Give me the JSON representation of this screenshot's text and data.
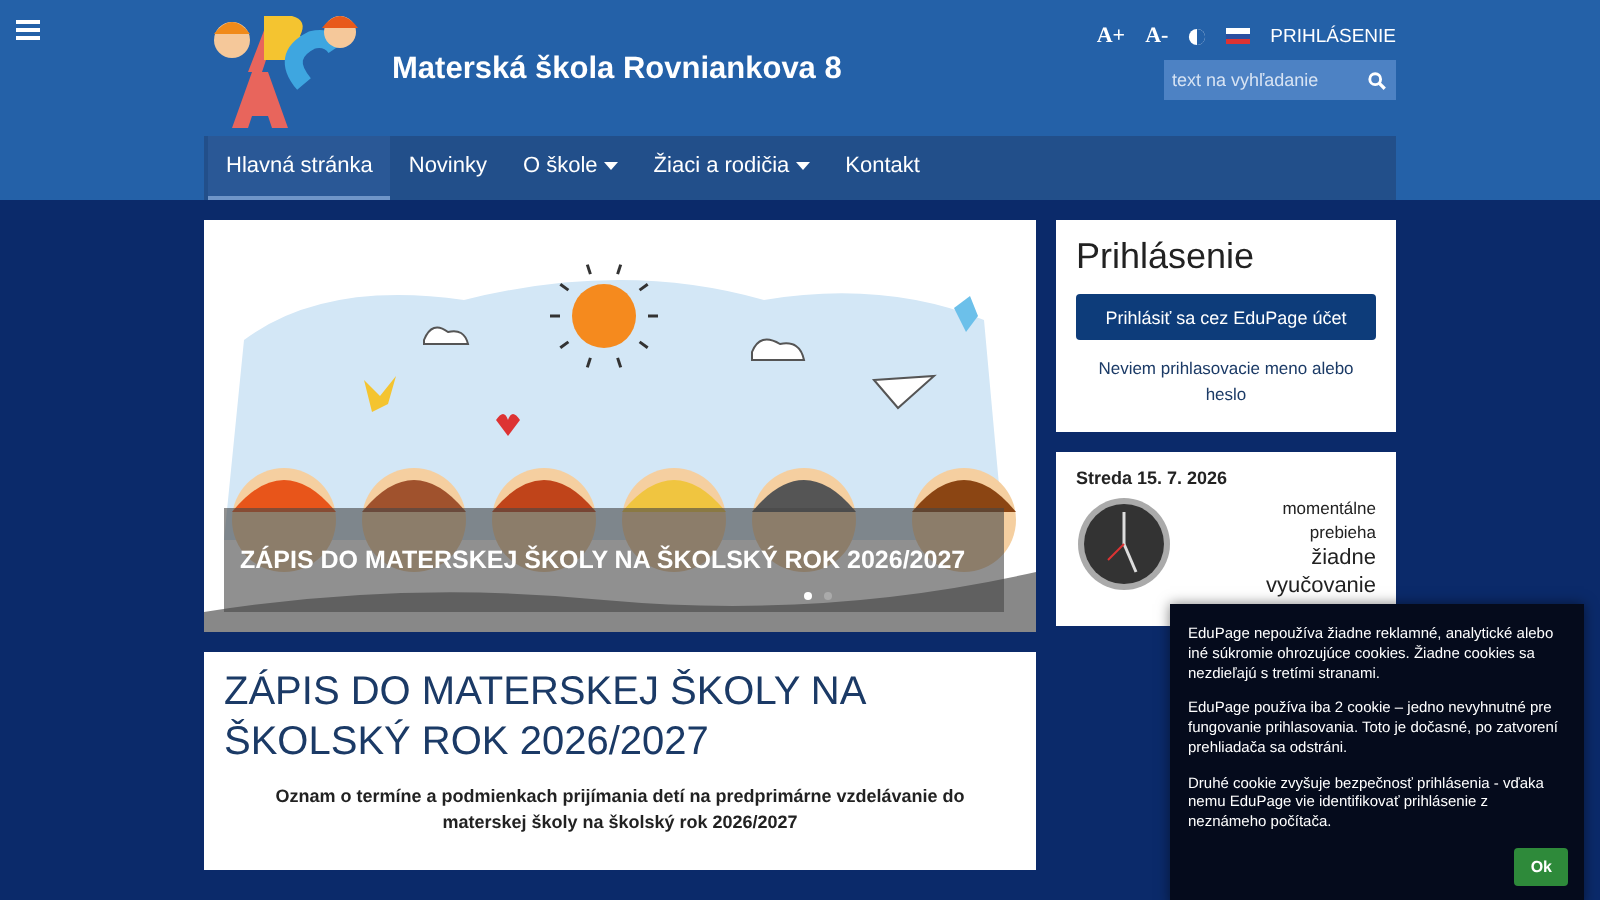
{
  "header": {
    "title": "Materská škola Rovniankova 8",
    "tools": [
      "A+",
      "A-"
    ],
    "login_link": "PRIHLÁSENIE",
    "search": {
      "placeholder": "text na vyhľadanie"
    }
  },
  "nav": [
    {
      "label": "Hlavná stránka",
      "selected": true,
      "dropdown": false
    },
    {
      "label": "Novinky",
      "selected": false,
      "dropdown": false
    },
    {
      "label": "O škole",
      "selected": false,
      "dropdown": true
    },
    {
      "label": "Žiaci a rodičia",
      "selected": false,
      "dropdown": true
    },
    {
      "label": "Kontakt",
      "selected": false,
      "dropdown": false
    }
  ],
  "slider": {
    "caption": "ZÁPIS DO MATERSKEJ ŠKOLY NA ŠKOLSKÝ ROK 2026/2027",
    "dots": [
      {
        "selected": true
      },
      {
        "selected": false
      }
    ]
  },
  "article": {
    "title": "ZÁPIS DO MATERSKEJ ŠKOLY NA ŠKOLSKÝ ROK 2026/2027",
    "lead": "Oznam o termíne a podmienkach prijímania detí na predprimárne vzdelávanie do materskej školy na školský rok 2026/2027"
  },
  "login": {
    "title": "Prihlásenie",
    "button": "Prihlásiť sa cez EduPage účet",
    "forgot": "Neviem prihlasovacie meno alebo heslo"
  },
  "day": {
    "date": "Streda 15. 7. 2026",
    "status": [
      "momentálne",
      "prebieha"
    ],
    "lesson": [
      "žiadne",
      "vyučovanie"
    ]
  },
  "cookie": {
    "paragraphs": [
      "EduPage nepoužíva žiadne reklamné, analytické alebo iné súkromie ohrozujúce cookies. Žiadne cookies sa nezdieľajú s tretími stranami.",
      "EduPage používa iba 2 cookie – jedno nevyhnutné pre fungovanie prihlasovania. Toto je dočasné, po zatvorení prehliadača sa odstráni.",
      "Druhé cookie zvyšuje bezpečnosť prihlásenia - vďaka nemu EduPage vie identifikovať prihlásenie z neznámeho počítača."
    ],
    "button": "Ok"
  }
}
